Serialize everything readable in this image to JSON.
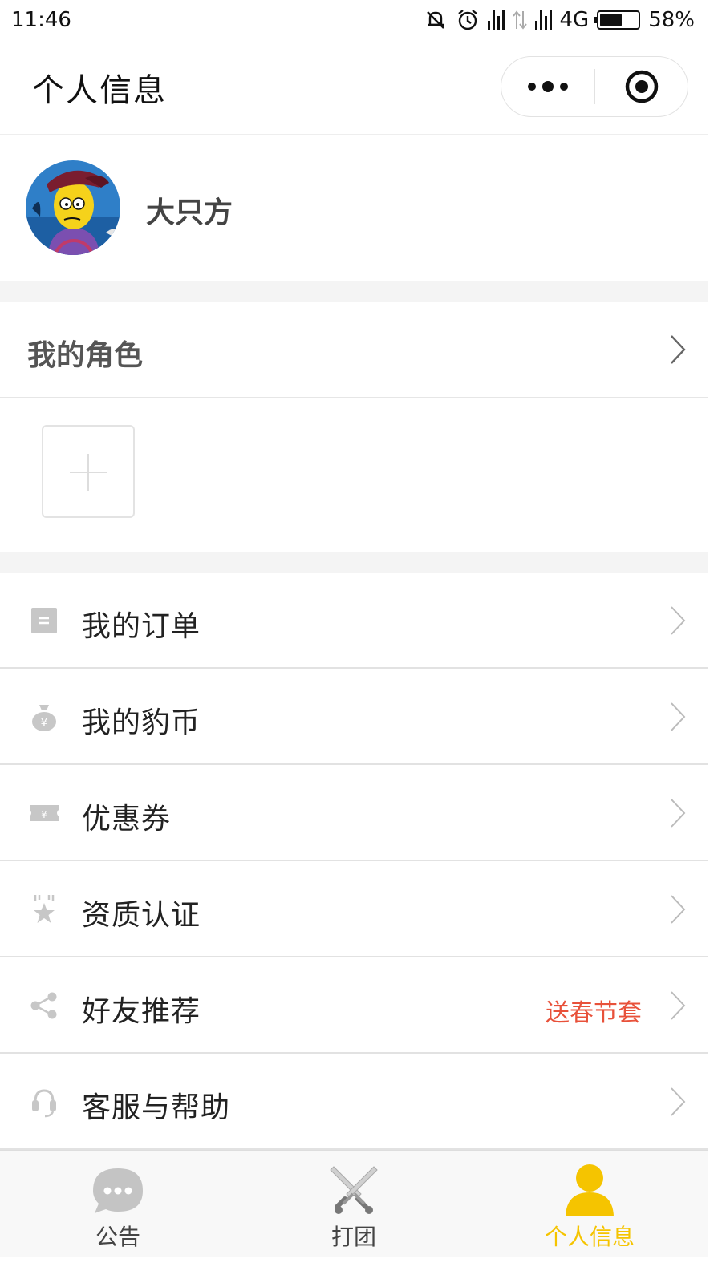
{
  "status_bar": {
    "time": "11:46",
    "network": "4G",
    "battery": "58%",
    "battery_level": 0.58
  },
  "header": {
    "title": "个人信息",
    "more_icon": "more-dots-icon",
    "target_icon": "target-circle-icon"
  },
  "profile": {
    "username": "大只方",
    "avatar_icon": "avatar-cartoon"
  },
  "roles": {
    "title": "我的角色",
    "add_icon": "plus-icon"
  },
  "menu": [
    {
      "label": "我的订单",
      "icon": "order-list-icon",
      "promo": ""
    },
    {
      "label": "我的豹币",
      "icon": "money-bag-icon",
      "promo": ""
    },
    {
      "label": "优惠券",
      "icon": "coupon-icon",
      "promo": ""
    },
    {
      "label": "资质认证",
      "icon": "badge-star-icon",
      "promo": ""
    },
    {
      "label": "好友推荐",
      "icon": "share-icon",
      "promo": "送春节套"
    },
    {
      "label": "客服与帮助",
      "icon": "headset-icon",
      "promo": ""
    }
  ],
  "tabs": [
    {
      "label": "公告",
      "icon": "chat-bubble-icon",
      "active": false
    },
    {
      "label": "打团",
      "icon": "crossed-swords-icon",
      "active": false
    },
    {
      "label": "个人信息",
      "icon": "person-icon",
      "active": true
    }
  ],
  "colors": {
    "accent": "#f5c400",
    "promo": "#e8513a",
    "icon_gray": "#c7c7c7",
    "section_gap": "#f4f4f4"
  }
}
